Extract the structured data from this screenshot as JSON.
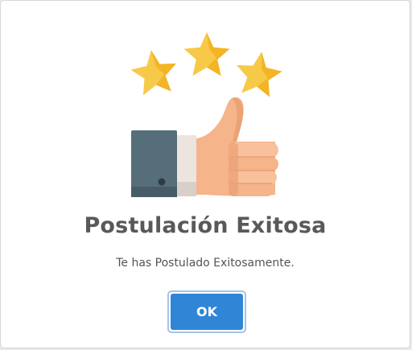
{
  "dialog": {
    "title": "Postulación Exitosa",
    "message": "Te has Postulado Exitosamente.",
    "ok_label": "OK"
  },
  "icons": {
    "illustration": "thumbs-up-with-stars-icon",
    "star": "star-icon",
    "thumb": "thumbs-up-icon"
  },
  "colors": {
    "button": "#3085d6",
    "title_text": "#595959",
    "star_gold": "#f7c948",
    "star_shade": "#f0a30a",
    "sleeve": "#566d7a",
    "skin": "#f5b48a"
  }
}
